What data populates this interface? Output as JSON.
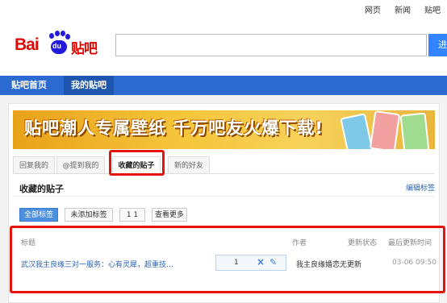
{
  "top_links": [
    "网页",
    "新闻",
    "贴吧"
  ],
  "logo": {
    "bai": "Bai",
    "du": "du",
    "tieba": "贴吧"
  },
  "search": {
    "button_label": "进"
  },
  "nav": {
    "home": "贴吧首页",
    "mine": "我的贴吧"
  },
  "banner": {
    "text": "贴吧潮人专属壁纸 千万吧友火爆下载!"
  },
  "tabs": [
    "回复我的",
    "@提到我的",
    "收藏的贴子",
    "新的好友"
  ],
  "section": {
    "title": "收藏的贴子",
    "edit_tags": "编辑标签"
  },
  "filters": [
    "全部标签",
    "未添加标签",
    "1 1",
    "查看更多"
  ],
  "table": {
    "headers": {
      "title": "标题",
      "author": "作者",
      "status": "更新状态",
      "last_update": "最后更新时间"
    },
    "rows": [
      {
        "title": "武汉我主良缘三对一服务：心有灵犀，超重技…",
        "count": "1",
        "author": "我主良缘婚恋",
        "status": "无更新",
        "time": "03-06 09:50"
      }
    ]
  },
  "colors": {
    "accent_blue": "#2b6ad0",
    "highlight_red": "#e3140b",
    "link_blue": "#2d64b3"
  }
}
